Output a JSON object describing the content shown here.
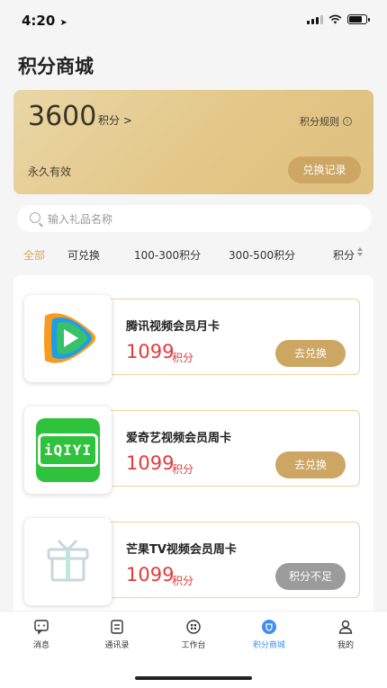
{
  "status": {
    "time": "4:20",
    "location_icon": "location-arrow-icon",
    "icons": [
      "signal-icon",
      "wifi-icon",
      "battery-icon"
    ]
  },
  "page": {
    "title": "积分商城"
  },
  "points": {
    "value": "3600",
    "unit": "积分 >",
    "rules_label": "积分规则",
    "info_icon": "ⓘ",
    "validity": "永久有效",
    "history_button": "兑换记录"
  },
  "search": {
    "placeholder": "输入礼品名称"
  },
  "filters": {
    "items": [
      "全部",
      "可兑换",
      "100-300积分",
      "300-500积分",
      "积分"
    ],
    "active": "全部"
  },
  "gifts": [
    {
      "name": "腾讯视频会员月卡",
      "price": "1099",
      "unit": "积分",
      "button": "去兑换",
      "enabled": true,
      "icon": "tencent-video-logo"
    },
    {
      "name": "爱奇艺视频会员周卡",
      "price": "1099",
      "unit": "积分",
      "button": "去兑换",
      "enabled": true,
      "icon": "iqiyi-logo",
      "logo_text": "iQIYI"
    },
    {
      "name": "芒果TV视频会员周卡",
      "price": "1099",
      "unit": "积分",
      "button": "积分不足",
      "enabled": false,
      "icon": "gift-box-icon"
    }
  ],
  "tabbar": {
    "items": [
      {
        "label": "消息",
        "icon": "message-icon"
      },
      {
        "label": "通讯录",
        "icon": "contacts-icon"
      },
      {
        "label": "工作台",
        "icon": "workbench-icon"
      },
      {
        "label": "积分商城",
        "icon": "points-mall-icon",
        "active": true
      },
      {
        "label": "我的",
        "icon": "profile-icon"
      }
    ]
  },
  "colors": {
    "gold": "#cda664",
    "price_red": "#e23b3b",
    "tab_active": "#3d8ef0",
    "disabled": "#9b9b9b"
  }
}
